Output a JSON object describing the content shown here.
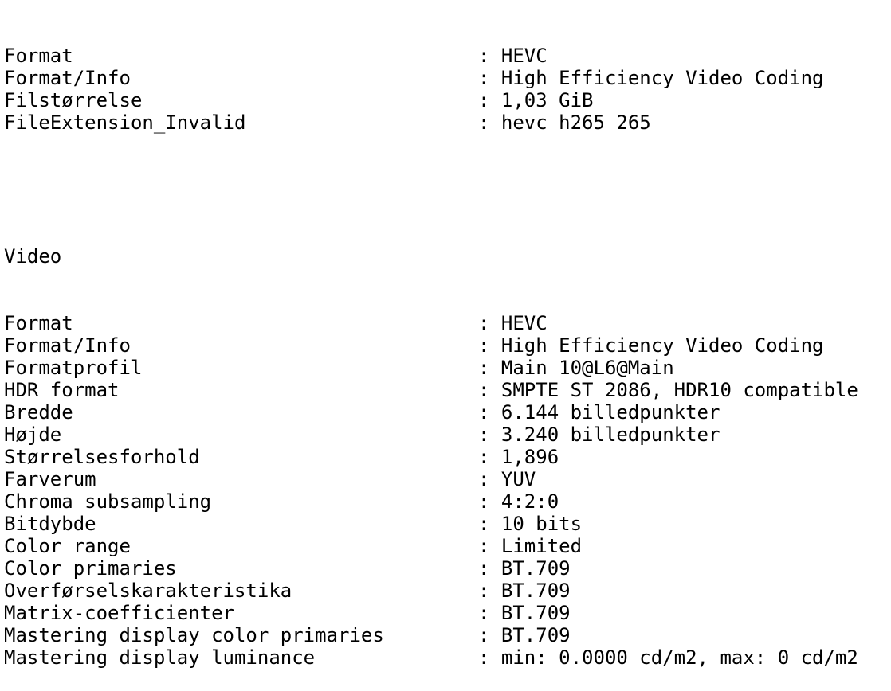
{
  "general": [
    {
      "label": "Format",
      "value": "HEVC"
    },
    {
      "label": "Format/Info",
      "value": "High Efficiency Video Coding"
    },
    {
      "label": "Filstørrelse",
      "value": "1,03 GiB"
    },
    {
      "label": "FileExtension_Invalid",
      "value": "hevc h265 265"
    }
  ],
  "video": {
    "heading": "Video",
    "rows": [
      {
        "label": "Format",
        "value": "HEVC"
      },
      {
        "label": "Format/Info",
        "value": "High Efficiency Video Coding"
      },
      {
        "label": "Formatprofil",
        "value": "Main 10@L6@Main"
      },
      {
        "label": "HDR format",
        "value": "SMPTE ST 2086, HDR10 compatible"
      },
      {
        "label": "Bredde",
        "value": "6.144 billedpunkter"
      },
      {
        "label": "Højde",
        "value": "3.240 billedpunkter"
      },
      {
        "label": "Størrelsesforhold",
        "value": "1,896"
      },
      {
        "label": "Farverum",
        "value": "YUV"
      },
      {
        "label": "Chroma subsampling",
        "value": "4:2:0"
      },
      {
        "label": "Bitdybde",
        "value": "10 bits"
      },
      {
        "label": "Color range",
        "value": "Limited"
      },
      {
        "label": "Color primaries",
        "value": "BT.709"
      },
      {
        "label": "Overførselskarakteristika",
        "value": "BT.709"
      },
      {
        "label": "Matrix-coefficienter",
        "value": "BT.709"
      },
      {
        "label": "Mastering display color primaries",
        "value": "BT.709"
      },
      {
        "label": "Mastering display luminance",
        "value": "min: 0.0000 cd/m2, max: 0 cd/m2"
      }
    ]
  }
}
